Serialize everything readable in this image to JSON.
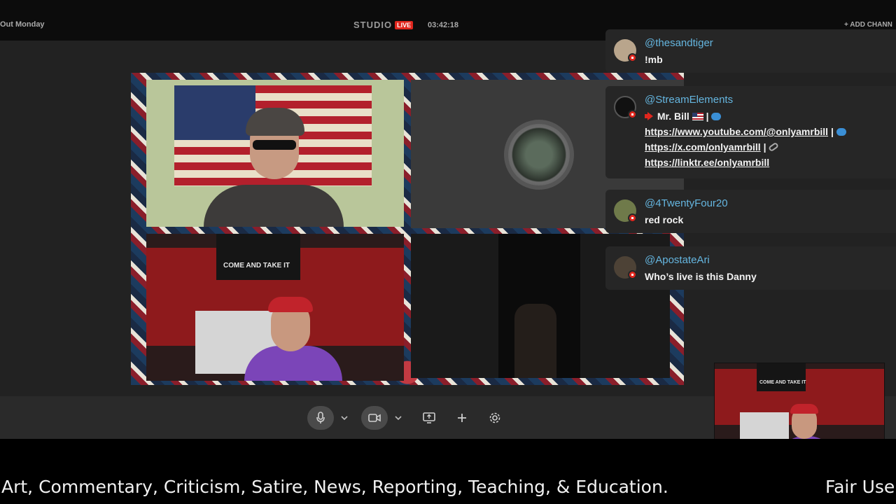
{
  "topbar": {
    "left_text": "Out Monday",
    "studio_label": "STUDIO",
    "live_label": "LIVE",
    "timer": "03:42:18",
    "add_channel_label": "+ ADD CHANN"
  },
  "stage": {
    "banner_text": "COME AND TAKE IT"
  },
  "chat": {
    "messages": [
      {
        "user": "@thesandtiger",
        "text": "!mb"
      },
      {
        "user": "@StreamElements",
        "line1_text": "Mr. Bill",
        "link_youtube": "https://www.youtube.com/@onlyamrbill",
        "link_x": "https://x.com/onlyamrbill",
        "link_linktree": "https://linktr.ee/onlyamrbill",
        "separator": "|"
      },
      {
        "user": "@4TwentyFour20",
        "text": "red rock"
      },
      {
        "user": "@ApostateAri",
        "text": "Who’s live is this Danny"
      }
    ]
  },
  "controls": {
    "icons": [
      "microphone-icon",
      "camera-icon",
      "screen-share-icon",
      "plus-icon",
      "gear-icon"
    ]
  },
  "ticker": {
    "text": "Art, Commentary, Criticism, Satire, News, Reporting, Teaching, & Education.",
    "text_2": "Fair Use"
  },
  "colors": {
    "live_red": "#e0261d",
    "username_blue": "#65b6e0",
    "chat_bg": "#262626"
  }
}
